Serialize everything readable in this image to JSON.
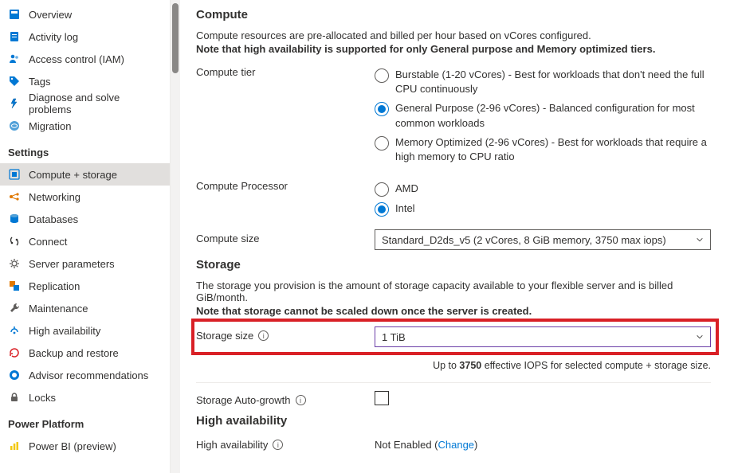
{
  "sidebar": {
    "items_top": [
      {
        "label": "Overview",
        "icon": "overview"
      },
      {
        "label": "Activity log",
        "icon": "activity"
      },
      {
        "label": "Access control (IAM)",
        "icon": "access"
      },
      {
        "label": "Tags",
        "icon": "tags"
      },
      {
        "label": "Diagnose and solve problems",
        "icon": "diagnose"
      },
      {
        "label": "Migration",
        "icon": "migration"
      }
    ],
    "section_settings": "Settings",
    "items_settings": [
      {
        "label": "Compute + storage",
        "icon": "compute",
        "selected": true
      },
      {
        "label": "Networking",
        "icon": "networking"
      },
      {
        "label": "Databases",
        "icon": "databases"
      },
      {
        "label": "Connect",
        "icon": "connect"
      },
      {
        "label": "Server parameters",
        "icon": "params"
      },
      {
        "label": "Replication",
        "icon": "replication"
      },
      {
        "label": "Maintenance",
        "icon": "maintenance"
      },
      {
        "label": "High availability",
        "icon": "ha"
      },
      {
        "label": "Backup and restore",
        "icon": "backup"
      },
      {
        "label": "Advisor recommendations",
        "icon": "advisor"
      },
      {
        "label": "Locks",
        "icon": "locks"
      }
    ],
    "section_power": "Power Platform",
    "items_power": [
      {
        "label": "Power BI (preview)",
        "icon": "powerbi"
      }
    ]
  },
  "main": {
    "compute": {
      "heading": "Compute",
      "desc1": "Compute resources are pre-allocated and billed per hour based on vCores configured.",
      "desc2": "Note that high availability is supported for only General purpose and Memory optimized tiers.",
      "tier_label": "Compute tier",
      "tier_options": [
        {
          "text": "Burstable (1-20 vCores) - Best for workloads that don't need the full CPU continuously",
          "checked": false
        },
        {
          "text": "General Purpose (2-96 vCores) - Balanced configuration for most common workloads",
          "checked": true
        },
        {
          "text": "Memory Optimized (2-96 vCores) - Best for workloads that require a high memory to CPU ratio",
          "checked": false
        }
      ],
      "proc_label": "Compute Processor",
      "proc_options": [
        {
          "text": "AMD",
          "checked": false
        },
        {
          "text": "Intel",
          "checked": true
        }
      ],
      "size_label": "Compute size",
      "size_value": "Standard_D2ds_v5 (2 vCores, 8 GiB memory, 3750 max iops)"
    },
    "storage": {
      "heading": "Storage",
      "desc1": "The storage you provision is the amount of storage capacity available to your flexible server and is billed GiB/month.",
      "desc2": "Note that storage cannot be scaled down once the server is created.",
      "size_label": "Storage size",
      "size_value": "1 TiB",
      "iops_prefix": "Up to ",
      "iops_value": "3750",
      "iops_suffix": " effective IOPS for selected compute + storage size.",
      "autogrow_label": "Storage Auto-growth"
    },
    "ha": {
      "heading": "High availability",
      "label": "High availability",
      "value_prefix": "Not Enabled (",
      "change": "Change",
      "value_suffix": ")"
    }
  }
}
